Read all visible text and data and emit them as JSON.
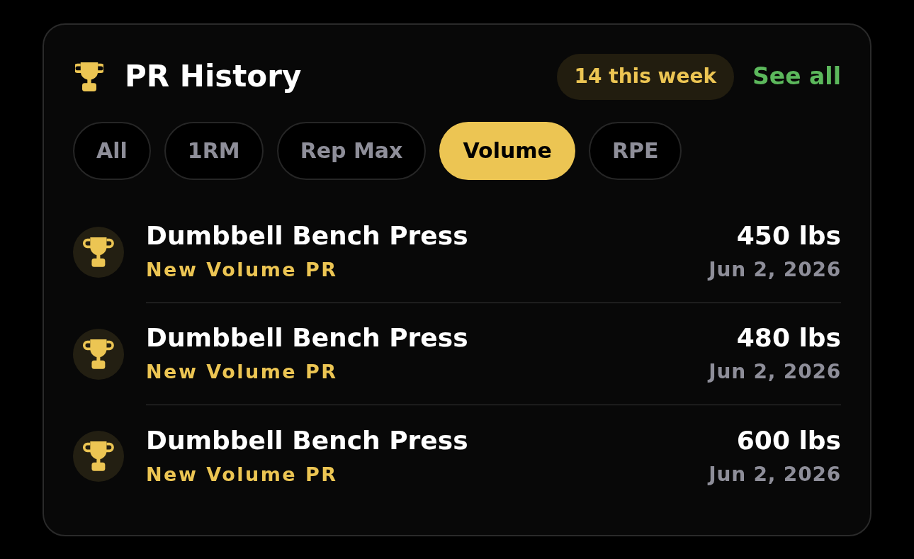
{
  "header": {
    "title": "PR History",
    "weekly_count": "14 this week",
    "link": "See all"
  },
  "filters": [
    {
      "label": "All",
      "selected": false
    },
    {
      "label": "1RM",
      "selected": false
    },
    {
      "label": "Rep Max",
      "selected": false
    },
    {
      "label": "Volume",
      "selected": true
    },
    {
      "label": "RPE",
      "selected": false
    }
  ],
  "records": [
    {
      "exercise": "Dumbbell Bench Press",
      "label": "New Volume PR",
      "value": "450 lbs",
      "date": "Jun 2, 2026"
    },
    {
      "exercise": "Dumbbell Bench Press",
      "label": "New Volume PR",
      "value": "480 lbs",
      "date": "Jun 2, 2026"
    },
    {
      "exercise": "Dumbbell Bench Press",
      "label": "New Volume PR",
      "value": "600 lbs",
      "date": "Jun 2, 2026"
    }
  ]
}
